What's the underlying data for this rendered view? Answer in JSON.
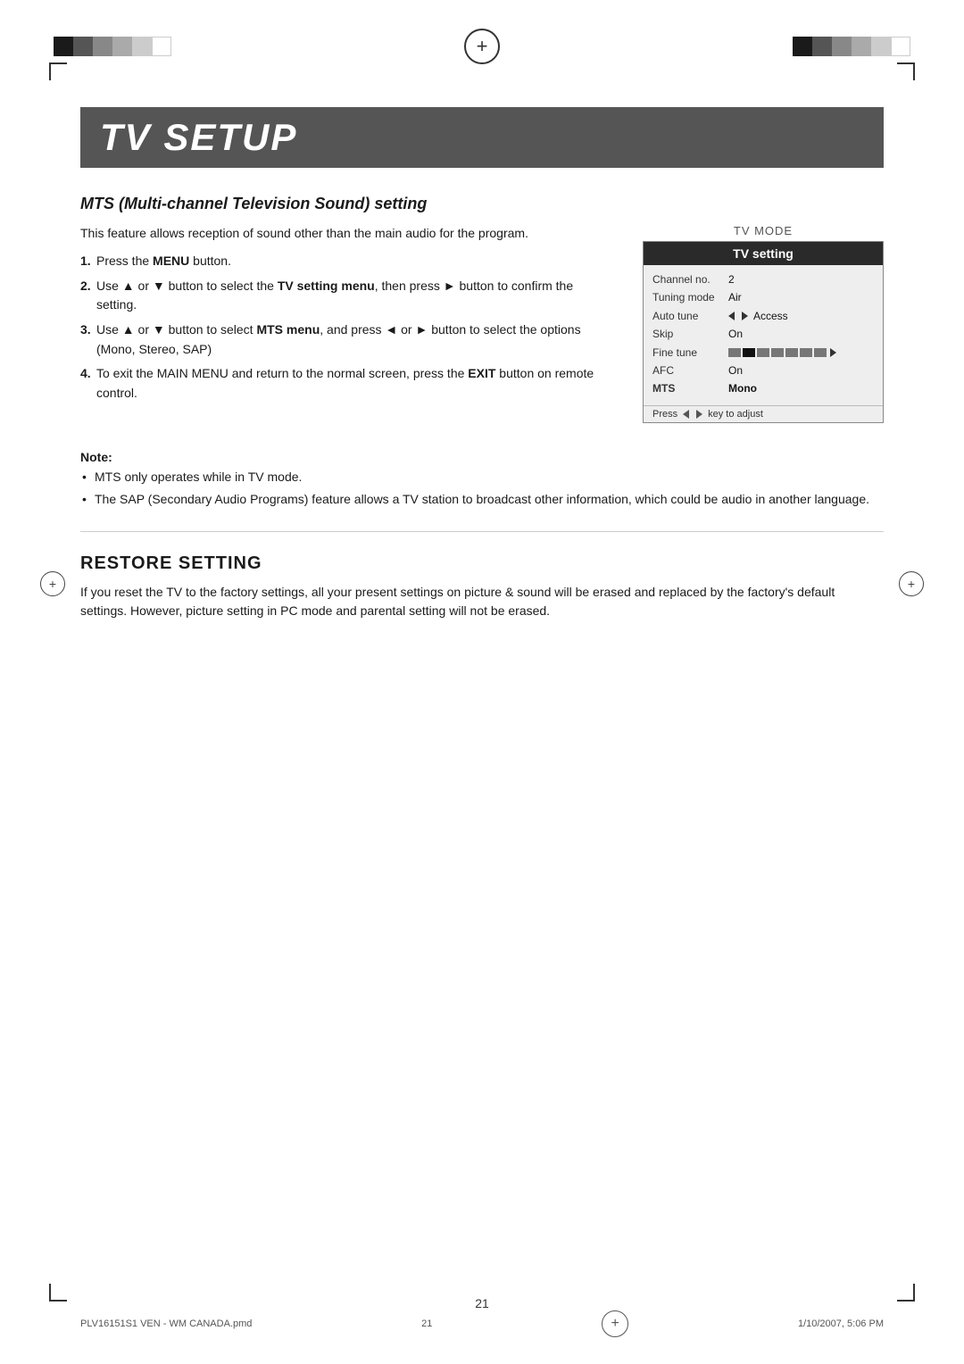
{
  "page": {
    "title": "TV SETUP",
    "number": "21",
    "footer_left": "PLV16151S1 VEN - WM CANADA.pmd",
    "footer_center": "21",
    "footer_right": "1/10/2007, 5:06 PM"
  },
  "mts_section": {
    "heading": "MTS (Multi-channel Television Sound) setting",
    "intro": "This feature allows reception of sound other than the main audio for the program.",
    "steps": [
      {
        "num": "1.",
        "text": "Press the MENU button."
      },
      {
        "num": "2.",
        "text": "Use ▲ or ▼ button to select the TV setting menu, then press ► button to confirm the setting."
      },
      {
        "num": "3.",
        "text": "Use ▲ or ▼ button to select MTS menu, and press ◄ or ► button to select the options (Mono, Stereo, SAP)"
      },
      {
        "num": "4.",
        "text": "To exit the MAIN MENU and return to the normal screen, press the EXIT button on remote control."
      }
    ]
  },
  "tv_panel": {
    "mode_label": "TV MODE",
    "header": "TV setting",
    "rows": [
      {
        "label": "Channel no.",
        "value": "2",
        "bold": false
      },
      {
        "label": "Tuning mode",
        "value": "Air",
        "bold": false
      },
      {
        "label": "Auto tune",
        "value": "Access",
        "bold": false,
        "has_arrows": true
      },
      {
        "label": "Skip",
        "value": "On",
        "bold": false
      },
      {
        "label": "Fine tune",
        "value": "",
        "bold": false,
        "has_bar": true
      },
      {
        "label": "AFC",
        "value": "On",
        "bold": false
      },
      {
        "label": "MTS",
        "value": "Mono",
        "bold": true,
        "highlighted": true
      }
    ],
    "footer": "Press ◄ ► key to adjust"
  },
  "note": {
    "label": "Note:",
    "bullets": [
      "MTS only operates while in TV mode.",
      "The SAP (Secondary Audio Programs) feature allows a TV station to broadcast other information, which could be audio in another language."
    ]
  },
  "restore_section": {
    "heading": "RESTORE SETTING",
    "body": "If you reset the TV to the factory settings, all your present settings on picture & sound will be erased and replaced by the factory's default settings. However, picture setting in PC mode and parental setting will not be erased."
  }
}
